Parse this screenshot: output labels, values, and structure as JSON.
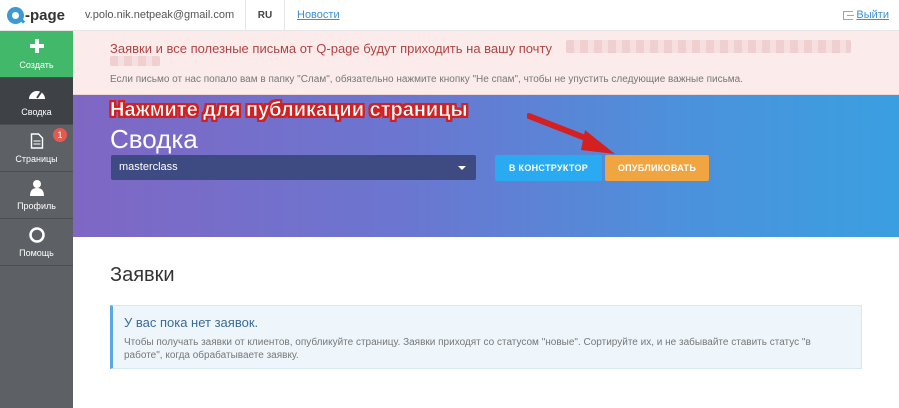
{
  "brand": {
    "logo_text": "-page"
  },
  "topbar": {
    "email": "v.polo.nik.netpeak@gmail.com",
    "lang": "RU",
    "news": "Новости",
    "logout": "Выйти"
  },
  "sidebar": {
    "items": [
      {
        "label": "Создать",
        "icon": "plus-icon"
      },
      {
        "label": "Сводка",
        "icon": "dashboard-icon"
      },
      {
        "label": "Страницы",
        "icon": "document-icon",
        "badge": "1"
      },
      {
        "label": "Профиль",
        "icon": "user-icon"
      },
      {
        "label": "Помощь",
        "icon": "lifebuoy-icon"
      }
    ]
  },
  "alert": {
    "title": "Заявки и все полезные письма от Q-page будут приходить на вашу почту",
    "note": "Если письмо от нас попало вам в папку \"Слам\", обязательно нажмите кнопку \"Не спам\", чтобы не упустить следующие важные письма."
  },
  "hero": {
    "callout": "Нажмите для публикации страницы",
    "title": "Сводка",
    "select_value": "masterclass",
    "builder_button": "В КОНСТРУКТОР",
    "publish_button": "ОПУБЛИКОВАТЬ"
  },
  "requests": {
    "title": "Заявки",
    "empty_title": "У вас пока нет заявок.",
    "empty_text": "Чтобы получать заявки от клиентов, опубликуйте страницу. Заявки приходят со статусом \"новые\". Сортируйте их, и не забывайте ставить статус \"в работе\", когда обрабатываете заявку."
  },
  "colors": {
    "create": "#41b86a",
    "sidebar": "#5d6064",
    "builder_button": "#2aaaf0",
    "publish_button": "#f0a541",
    "callout_red": "#d42020"
  }
}
